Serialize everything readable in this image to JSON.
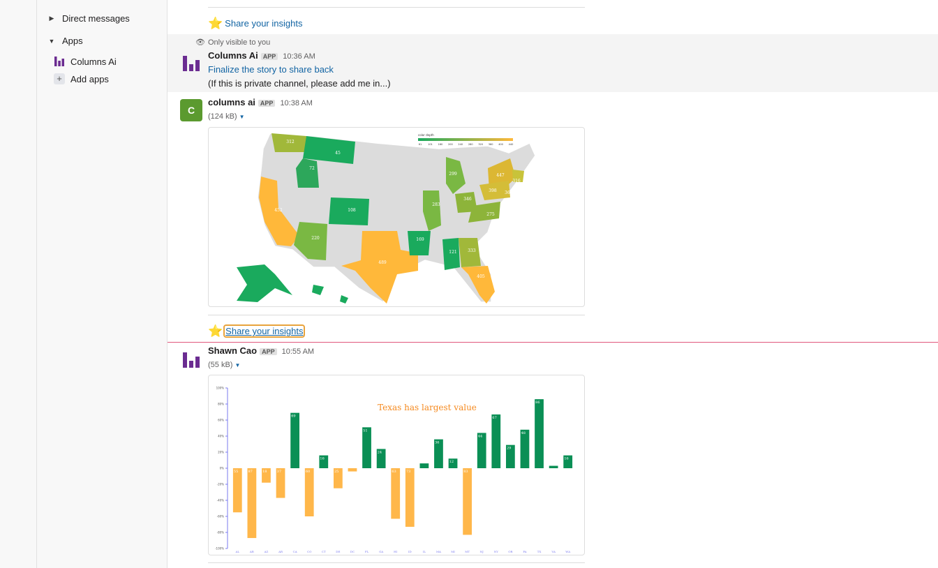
{
  "sidebar": {
    "direct_messages": "Direct messages",
    "apps": "Apps",
    "app_items": [
      {
        "label": "Columns Ai",
        "icon": "columns-ai-logo-icon"
      },
      {
        "label": "Add apps",
        "icon": "plus-icon"
      }
    ]
  },
  "messages": {
    "top_insight": "Share your insights",
    "ephemeral": {
      "visibility": "Only visible to you",
      "sender": "Columns Ai",
      "badge": "APP",
      "time": "10:36 AM",
      "link": "Finalize the story to share back",
      "note": "(If this is private channel, please add me in...)"
    },
    "map_msg": {
      "avatar_letter": "C",
      "sender": "columns ai",
      "badge": "APP",
      "time": "10:38 AM",
      "file_size": "(124 kB)",
      "insight": "Share your insights"
    },
    "chart_msg": {
      "sender": "Shawn Cao",
      "badge": "APP",
      "time": "10:55 AM",
      "file_size": "(55 kB)"
    }
  },
  "map_legend": {
    "title": "color depth",
    "ticks": [
      "61",
      "101",
      "160",
      "200",
      "240",
      "280",
      "320",
      "360",
      "400",
      "440"
    ]
  },
  "map_labels": [
    "312",
    "45",
    "72",
    "108",
    "452",
    "220",
    "34",
    "489",
    "169",
    "283",
    "299",
    "346",
    "447",
    "398",
    "316",
    "36",
    "275",
    "121",
    "333",
    "405"
  ],
  "chart_data": {
    "type": "bar",
    "title": "Texas has largest value",
    "categories": [
      "AL",
      "AR",
      "AZ",
      "AR",
      "CA",
      "CO",
      "CT",
      "DE",
      "DC",
      "FL",
      "GA",
      "HI",
      "ID",
      "IL",
      "MA",
      "MI",
      "MT",
      "NJ",
      "NY",
      "OR",
      "PA",
      "TX",
      "VA",
      "WA"
    ],
    "values": [
      -55,
      -87,
      -18,
      -37,
      69,
      -60,
      16,
      -25,
      -4,
      51,
      24,
      -63,
      -73,
      6,
      36,
      12,
      -83,
      44,
      67,
      29,
      48,
      86,
      3,
      16
    ],
    "value_labels": [
      "55",
      "87",
      "18",
      "37",
      "69",
      "60",
      "16",
      "25",
      "",
      "51",
      "24",
      "63",
      "73",
      "",
      "36",
      "12",
      "83",
      "44",
      "67",
      "29",
      "48",
      "86",
      "",
      "16"
    ],
    "yticks": [
      "100%",
      "80%",
      "60%",
      "40%",
      "20%",
      "0%",
      "-20%",
      "-40%",
      "-60%",
      "-80%",
      "-100%"
    ],
    "ylim": [
      -100,
      100
    ],
    "colors": {
      "positive": "#0a8f55",
      "negative": "#ffb74a",
      "title": "#f5891e",
      "axis": "#7a7aef"
    }
  },
  "colors": {
    "link": "#1264a3",
    "unread_line": "#e0567b",
    "accent": "#6b2c91"
  }
}
